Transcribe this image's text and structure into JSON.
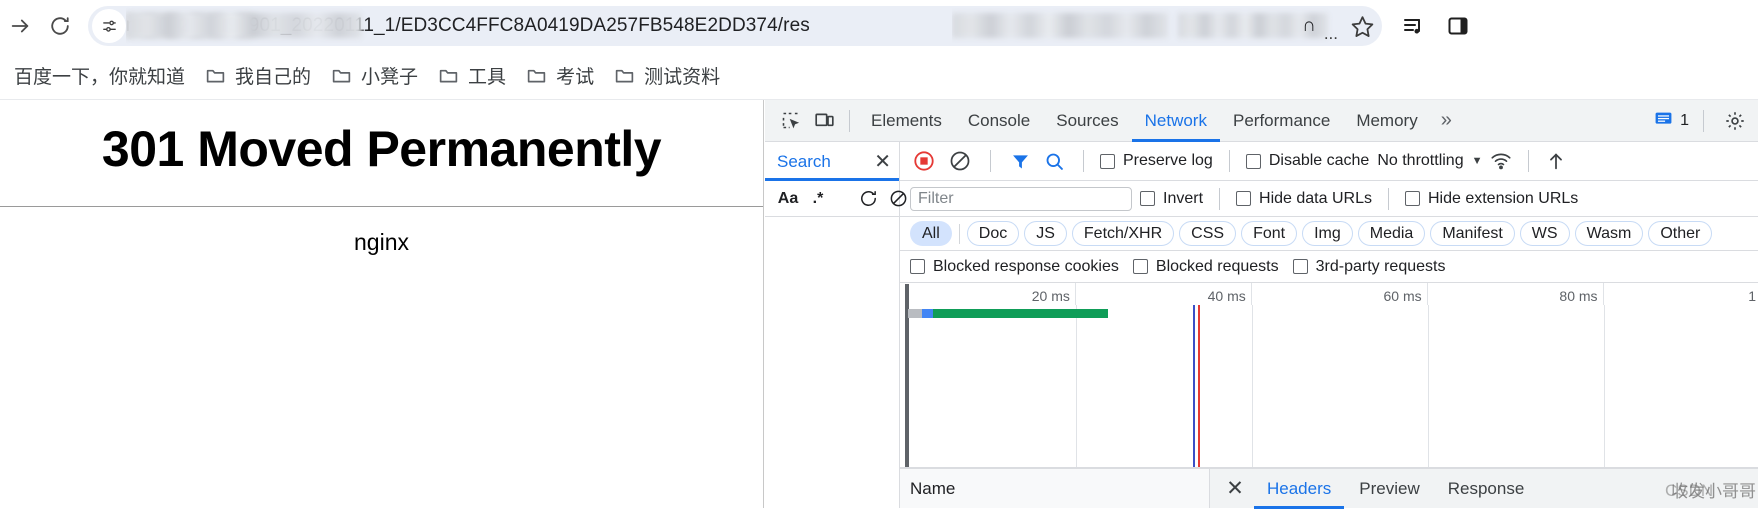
{
  "browser": {
    "nav": {
      "forward_label": "Forward",
      "reload_label": "Reload"
    },
    "omnibox": {
      "url_visible": "net/04296/391901_20220111_1/ED3CC4FFC8A0419DA257FB548E2DD374/res",
      "url_tail_glyph": "∩",
      "ellipsis": "...",
      "site_info_name": "site-information"
    },
    "actions": {
      "bookmark_label": "Bookmark this tab",
      "media_label": "Media controls",
      "sidepanel_label": "Side panel"
    }
  },
  "bookmarks": {
    "items": [
      {
        "label": "百度一下，你就知道",
        "folder": false
      },
      {
        "label": "我自己的",
        "folder": true
      },
      {
        "label": "小凳子",
        "folder": true
      },
      {
        "label": "工具",
        "folder": true
      },
      {
        "label": "考试",
        "folder": true
      },
      {
        "label": "测试资料",
        "folder": true
      }
    ]
  },
  "page": {
    "heading": "301 Moved Permanently",
    "server": "nginx"
  },
  "devtools": {
    "tabs": [
      {
        "label": "Elements",
        "active": false
      },
      {
        "label": "Console",
        "active": false
      },
      {
        "label": "Sources",
        "active": false
      },
      {
        "label": "Network",
        "active": true
      },
      {
        "label": "Performance",
        "active": false
      },
      {
        "label": "Memory",
        "active": false
      }
    ],
    "more_tabs_glyph": "»",
    "message_count": "1",
    "settings_label": "Settings",
    "inspect_label": "inspect-element",
    "device_label": "device-toolbar",
    "search": {
      "title": "Search",
      "close_glyph": "✕",
      "match_case": "Aa",
      "regex": ".*",
      "refresh_label": "refresh",
      "clear_label": "clear"
    },
    "network_toolbar": {
      "record_label": "record",
      "clear_label": "clear",
      "filter_label": "filter",
      "search_label": "search",
      "preserve_log": "Preserve log",
      "disable_cache": "Disable cache",
      "throttling": "No throttling",
      "caret": "▼",
      "wifi_label": "network-conditions",
      "import_label": "import-har",
      "export_label": "export-har"
    },
    "filter_bar": {
      "filter_placeholder": "Filter",
      "invert": "Invert",
      "hide_data_urls": "Hide data URLs",
      "hide_extension_urls": "Hide extension URLs"
    },
    "resource_types": [
      {
        "label": "All",
        "selected": true
      },
      {
        "label": "Doc",
        "selected": false
      },
      {
        "label": "JS",
        "selected": false
      },
      {
        "label": "Fetch/XHR",
        "selected": false
      },
      {
        "label": "CSS",
        "selected": false
      },
      {
        "label": "Font",
        "selected": false
      },
      {
        "label": "Img",
        "selected": false
      },
      {
        "label": "Media",
        "selected": false
      },
      {
        "label": "Manifest",
        "selected": false
      },
      {
        "label": "WS",
        "selected": false
      },
      {
        "label": "Wasm",
        "selected": false
      },
      {
        "label": "Other",
        "selected": false
      }
    ],
    "extra_filters": [
      {
        "label": "Blocked response cookies"
      },
      {
        "label": "Blocked requests"
      },
      {
        "label": "3rd-party requests"
      }
    ],
    "timeline": {
      "ticks": [
        "20 ms",
        "40 ms",
        "60 ms",
        "80 ms",
        "1"
      ],
      "bars": [
        {
          "type": "grey",
          "left_pct": 0.8,
          "width_pct": 1.6
        },
        {
          "type": "blue",
          "left_pct": 2.4,
          "width_pct": 1.3
        },
        {
          "type": "green",
          "left_pct": 3.7,
          "width_pct": 20.3
        }
      ],
      "events": [
        {
          "color": "blue",
          "left_pct": 34.1
        },
        {
          "color": "red",
          "left_pct": 34.6
        }
      ]
    },
    "request_table": {
      "name_column": "Name"
    },
    "detail_tabs": [
      {
        "label": "Headers",
        "active": true
      },
      {
        "label": "Preview",
        "active": false
      },
      {
        "label": "Response",
        "active": false
      }
    ],
    "detail_close_glyph": "✕"
  },
  "watermarks": {
    "right": "收发小哥哥",
    "center": "CSDN"
  },
  "colors": {
    "accent": "#1a73e8",
    "record": "#e53935",
    "bar_green": "#0f9d58",
    "bar_blue": "#4285f4",
    "toolbar_bg": "#f1f3f4"
  }
}
